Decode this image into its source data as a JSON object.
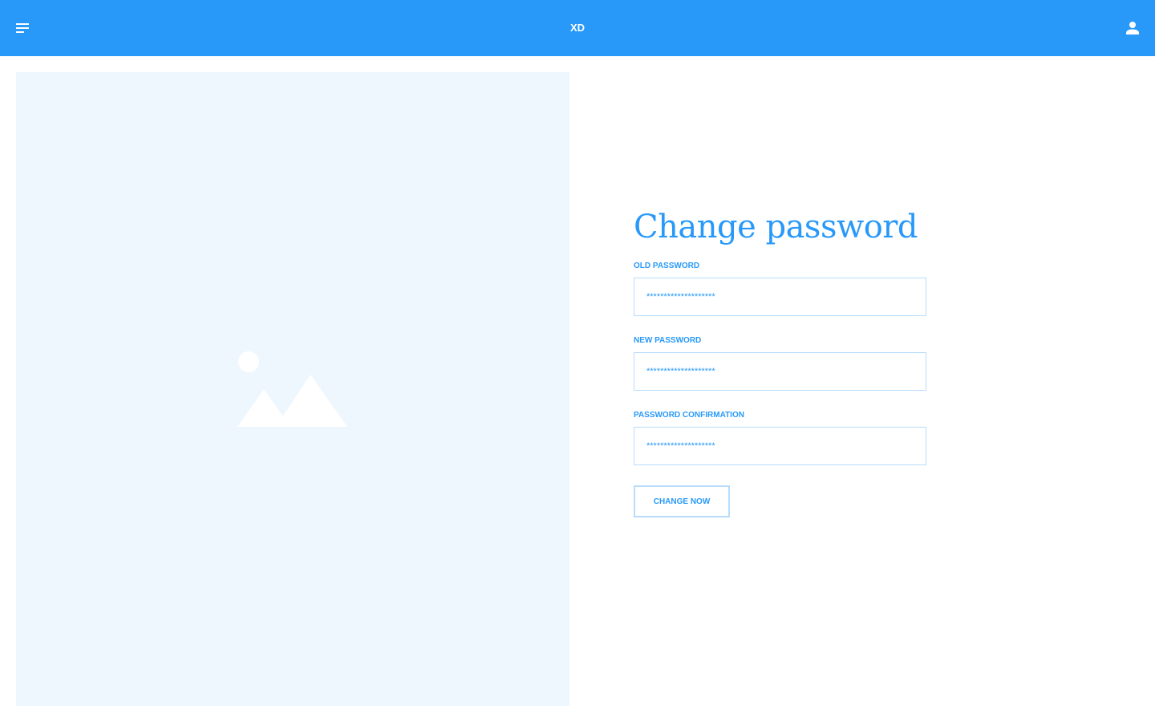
{
  "header": {
    "brand": "XD",
    "menu_icon": "menu-icon",
    "user_icon": "user-icon"
  },
  "hero": {
    "image_icon": "image-placeholder-icon"
  },
  "form": {
    "title": "Change password",
    "old_password": {
      "label": "OLD PASSWORD",
      "value": "********************"
    },
    "new_password": {
      "label": "NEW PASSWORD",
      "value": "********************"
    },
    "password_confirmation": {
      "label": "PASSWORD CONFIRMATION",
      "value": "********************"
    },
    "submit_label": "CHANGE NOW"
  },
  "colors": {
    "accent": "#2899f9",
    "field_border": "#b9dcfc",
    "hero_background": "#eef7fe",
    "background": "#ffffff"
  }
}
